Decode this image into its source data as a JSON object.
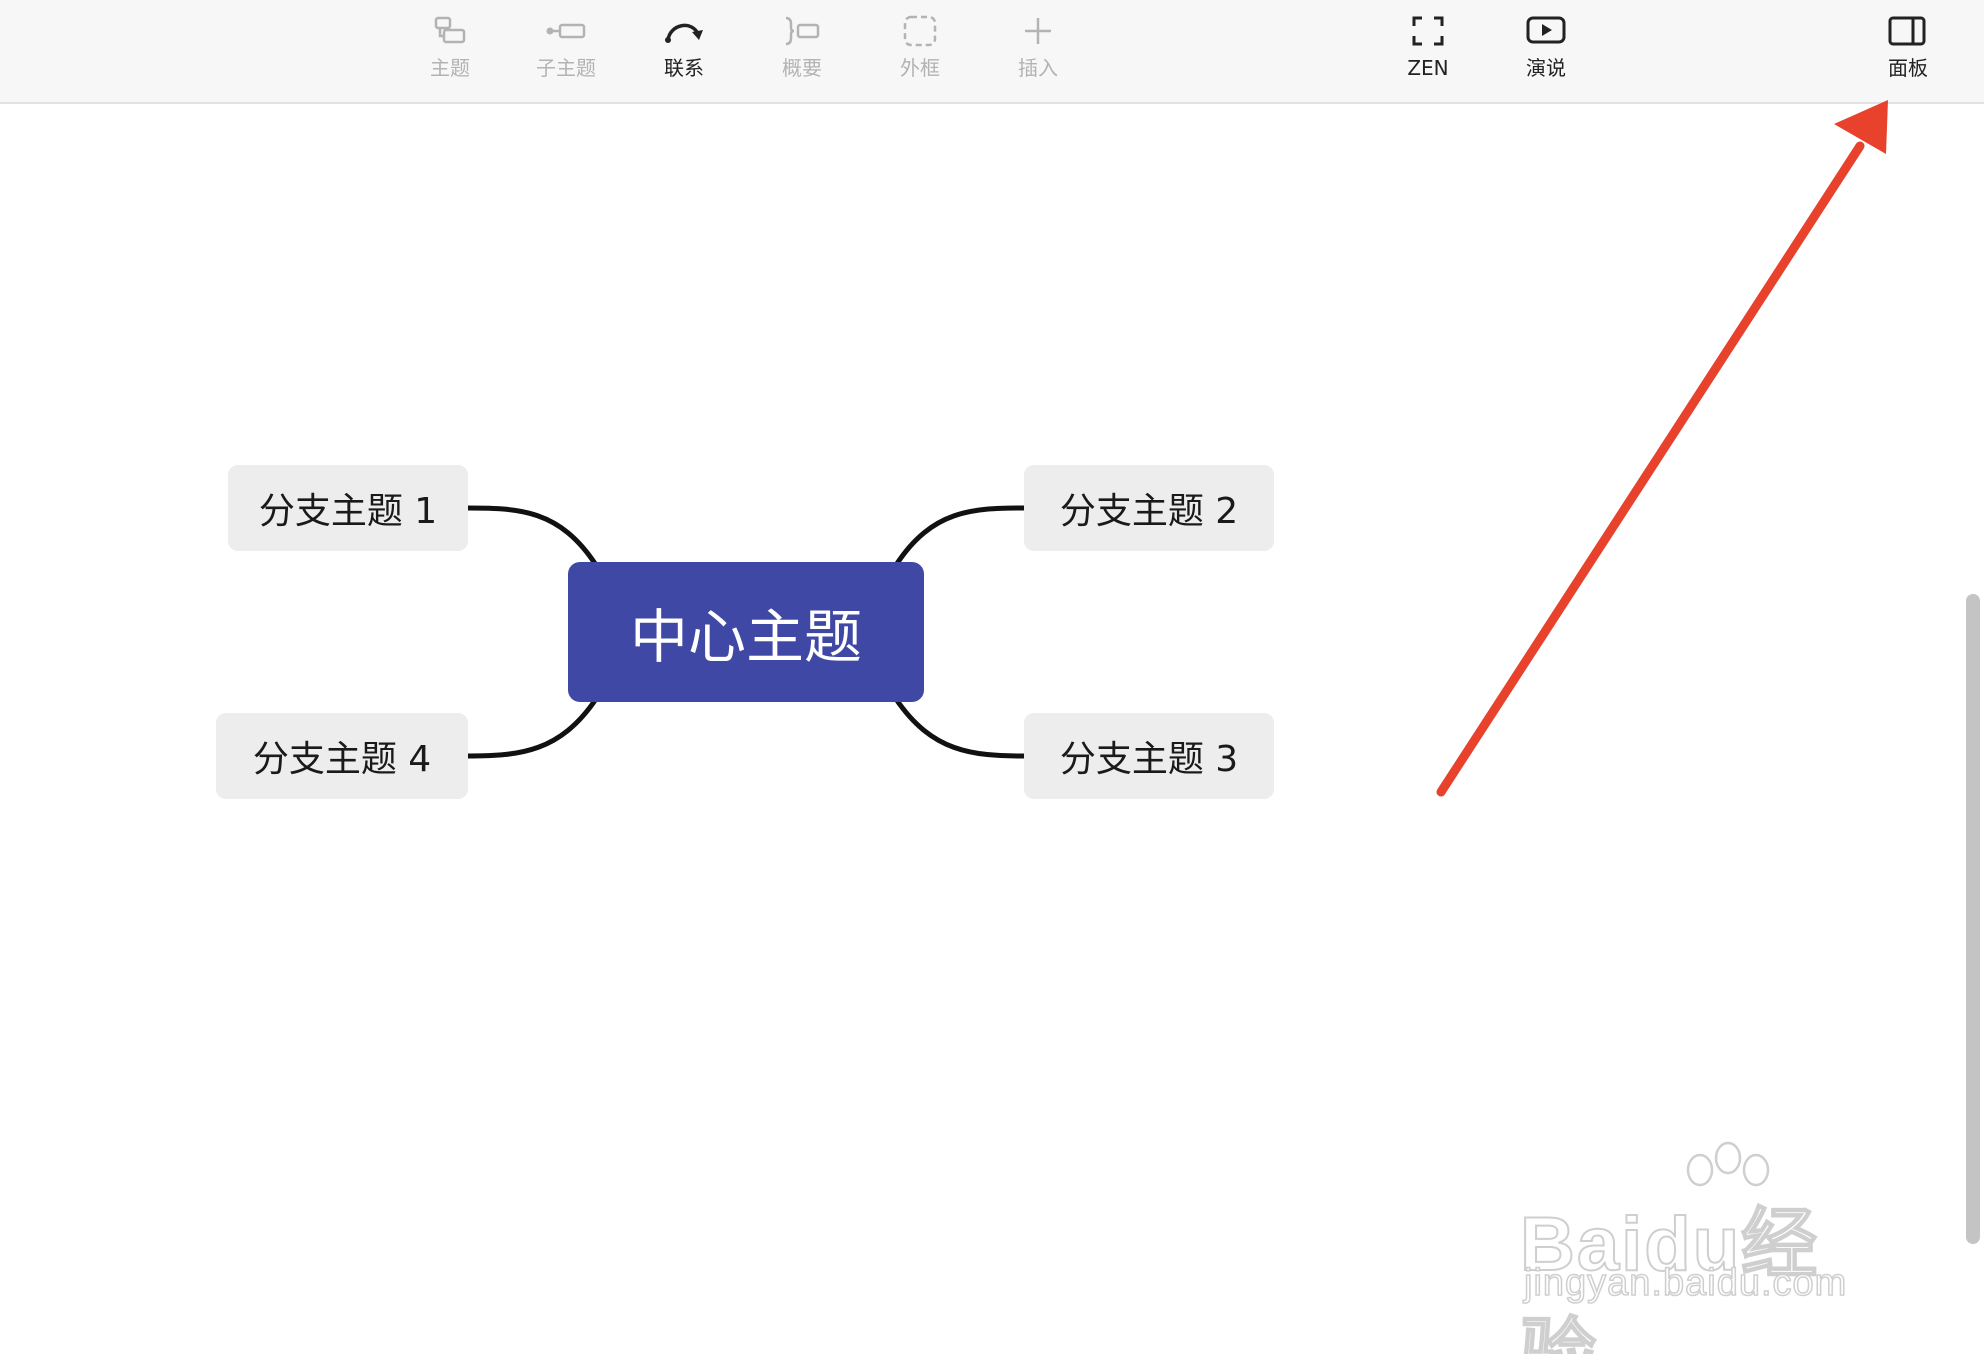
{
  "toolbar": {
    "items": [
      {
        "label": "主题",
        "icon": "topic-icon",
        "state": "disabled"
      },
      {
        "label": "子主题",
        "icon": "subtopic-icon",
        "state": "disabled"
      },
      {
        "label": "联系",
        "icon": "relationship-icon",
        "state": "enabled"
      },
      {
        "label": "概要",
        "icon": "summary-icon",
        "state": "disabled"
      },
      {
        "label": "外框",
        "icon": "boundary-icon",
        "state": "disabled"
      },
      {
        "label": "插入",
        "icon": "plus-icon",
        "state": "disabled"
      },
      {
        "label": "ZEN",
        "icon": "fullscreen-icon",
        "state": "enabled"
      },
      {
        "label": "演说",
        "icon": "play-icon",
        "state": "enabled"
      },
      {
        "label": "面板",
        "icon": "panel-icon",
        "state": "enabled"
      }
    ]
  },
  "mindmap": {
    "central": "中心主题",
    "branches": [
      "分支主题 1",
      "分支主题 2",
      "分支主题 3",
      "分支主题 4"
    ]
  },
  "annotation": {
    "arrow_color": "#e8412c",
    "arrow_target": "panel-button"
  },
  "watermark": {
    "brand": "Baidu经验",
    "url": "jingyan.baidu.com"
  },
  "colors": {
    "central_bg": "#3f49a5",
    "branch_bg": "#ededed",
    "toolbar_bg": "#f7f7f7"
  }
}
